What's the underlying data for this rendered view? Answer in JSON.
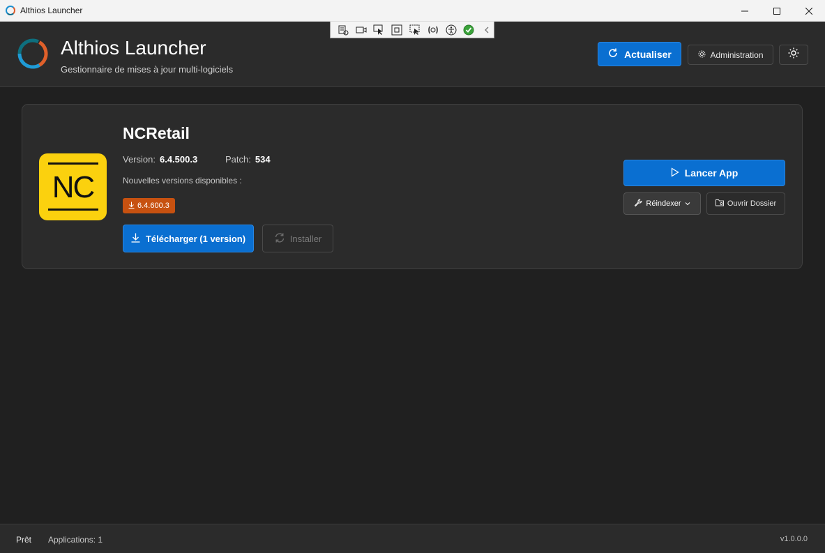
{
  "window": {
    "title": "Althios Launcher",
    "controls": [
      "minimize-icon",
      "maximize-icon",
      "close-icon"
    ]
  },
  "header": {
    "title": "Althios Launcher",
    "subtitle": "Gestionnaire de mises à jour multi-logiciels",
    "refresh_label": "Actualiser",
    "admin_label": "Administration",
    "theme_icon": "sun-icon"
  },
  "app": {
    "name": "NCRetail",
    "logo_text": "NC",
    "version_label": "Version:",
    "version_value": "6.4.500.3",
    "patch_label": "Patch:",
    "patch_value": "534",
    "available_label": "Nouvelles versions disponibles :",
    "available_versions": [
      "6.4.600.3"
    ],
    "download_label": "Télécharger (1 version)",
    "install_label": "Installer",
    "launch_label": "Lancer App",
    "reindex_label": "Réindexer",
    "open_folder_label": "Ouvrir Dossier"
  },
  "status": {
    "state": "Prêt",
    "apps_count": "Applications: 1",
    "version": "v1.0.0.0"
  },
  "colors": {
    "accent": "#0a6fd1",
    "badge": "#c75110",
    "background": "#202020",
    "surface": "#2b2b2b",
    "nc_logo": "#fbd10e"
  }
}
